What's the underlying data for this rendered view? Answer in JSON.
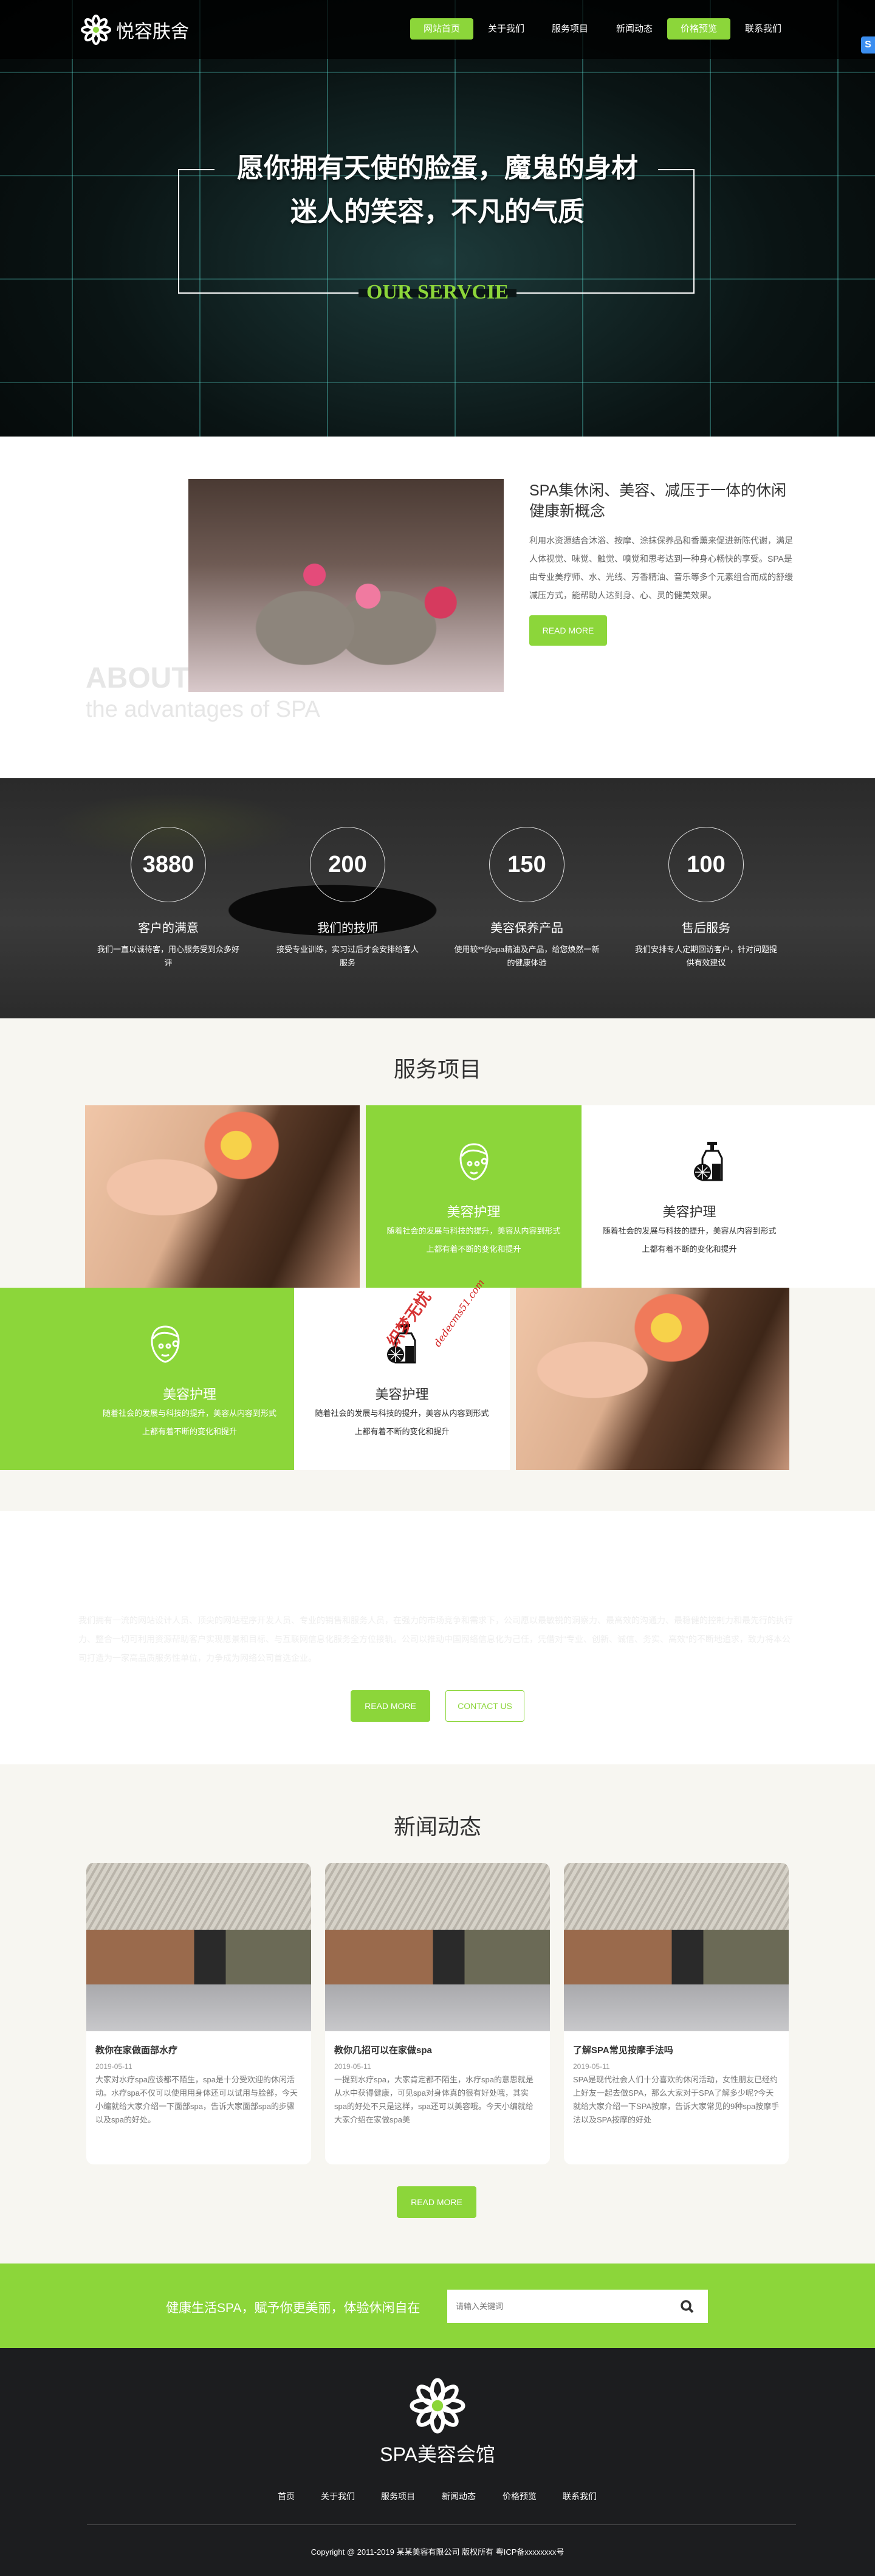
{
  "brand": {
    "name": "悦容肤舍",
    "accent": "#8cd63a",
    "dark": "#1c1d1f"
  },
  "nav": {
    "items": [
      {
        "label": "网站首页",
        "active": true
      },
      {
        "label": "关于我们"
      },
      {
        "label": "服务项目"
      },
      {
        "label": "新闻动态"
      },
      {
        "label": "价格预览",
        "active": true
      },
      {
        "label": "联系我们"
      }
    ]
  },
  "hero": {
    "line1": "愿你拥有天使的脸蛋，魔鬼的身材",
    "line2": "迷人的笑容，不凡的气质",
    "tag": "OUR SERVCIE"
  },
  "about": {
    "heading": "SPA集休闲、美容、减压于一体的休闲健康新概念",
    "text": "利用水资源结合沐浴、按摩、涂抹保养品和香薰来促进新陈代谢，满足人体视觉、味觉、触觉、嗅觉和思考达到一种身心畅快的享受。SPA是由专业美疗师、水、光线、芳香精油、音乐等多个元素组合而成的舒缓减压方式，能帮助人达到身、心、灵的健美效果。",
    "button": "READ MORE",
    "big": "ABOUT",
    "sub": "the advantages of SPA"
  },
  "stats": [
    {
      "value": "3880",
      "title": "客户的满意",
      "desc": "我们一直以诚待客，用心服务受到众多好评"
    },
    {
      "value": "200",
      "title": "我们的技师",
      "desc": "接受专业训练，实习过后才会安排给客人服务"
    },
    {
      "value": "150",
      "title": "美容保养产品",
      "desc": "使用较**的spa精油及产品，给您焕然一新的健康体验"
    },
    {
      "value": "100",
      "title": "售后服务",
      "desc": "我们安排专人定期回访客户，针对问题提供有效建议"
    }
  ],
  "services": {
    "title": "服务项目",
    "items": [
      {
        "icon": "face-mask-icon",
        "title": "美容护理",
        "desc1": "随着社会的发展与科技的提升，美容从内容到形式",
        "desc2": "上都有着不断的变化和提升"
      },
      {
        "icon": "lotion-bottle-icon",
        "title": "美容护理",
        "desc1": "随着社会的发展与科技的提升，美容从内容到形式",
        "desc2": "上都有着不断的变化和提升"
      },
      {
        "icon": "face-mask-icon",
        "title": "美容护理",
        "desc1": "随着社会的发展与科技的提升，美容从内容到形式",
        "desc2": "上都有着不断的变化和提升"
      },
      {
        "icon": "lotion-bottle-icon",
        "title": "美容护理",
        "desc1": "随着社会的发展与科技的提升，美容从内容到形式",
        "desc2": "上都有着不断的变化和提升"
      }
    ]
  },
  "watermark": {
    "text": "织梦无忧",
    "url": "dedecms51.com"
  },
  "intro": {
    "text": "我们拥有一流的网站设计人员、顶尖的网站程序开发人员、专业的销售和服务人员，在强力的市场竞争和需求下，公司愿以最敏锐的洞察力、最高效的沟通力、最稳健的控制力和最先行的执行力、整合一切可利用资源帮助客户实现愿景和目标、与互联网信息化服务全方位接轨。公司以推动中国网络信息化为己任，凭借对\"专业、创新、诚信、务实、高效\"的不断地追求，致力将本公司打造为一家高品质服务性单位，力争成为网络公司首选企业。",
    "read_more": "READ MORE",
    "contact": "CONTACT US"
  },
  "news": {
    "title": "新闻动态",
    "more": "READ MORE",
    "items": [
      {
        "title": "教你在家做面部水疗",
        "date": "2019-05-11",
        "desc": "大家对水疗spa应该都不陌生，spa是十分受欢迎的休闲活动。水疗spa不仅可以使用用身体还可以试用与脸部，今天小编就给大家介绍一下面部spa，告诉大家面部spa的步骤以及spa的好处。"
      },
      {
        "title": "教你几招可以在家做spa",
        "date": "2019-05-11",
        "desc": "一提到水疗spa，大家肯定都不陌生，水疗spa的意思就是从水中获得健康，可见spa对身体真的很有好处哦，其实spa的好处不只是这样，spa还可以美容哦。今天小编就给大家介绍在家做spa美"
      },
      {
        "title": "了解SPA常见按摩手法吗",
        "date": "2019-05-11",
        "desc": "SPA是现代社会人们十分喜欢的休闲活动，女性朋友已经约上好友一起去做SPA，那么大家对于SPA了解多少呢?今天就给大家介绍一下SPA按摩，告诉大家常见的9种spa按摩手法以及SPA按摩的好处"
      }
    ]
  },
  "band": {
    "slogan": "健康生活SPA，赋予你更美丽，体验休闲自在",
    "search_placeholder": "请输入关键词"
  },
  "footer": {
    "title": "SPA美容会馆",
    "nav": [
      "首页",
      "关于我们",
      "服务项目",
      "新闻动态",
      "价格预览",
      "联系我们"
    ],
    "copyright": "Copyright @ 2011-2019 某某美容有限公司 版权所有 粤ICP备xxxxxxxx号"
  }
}
